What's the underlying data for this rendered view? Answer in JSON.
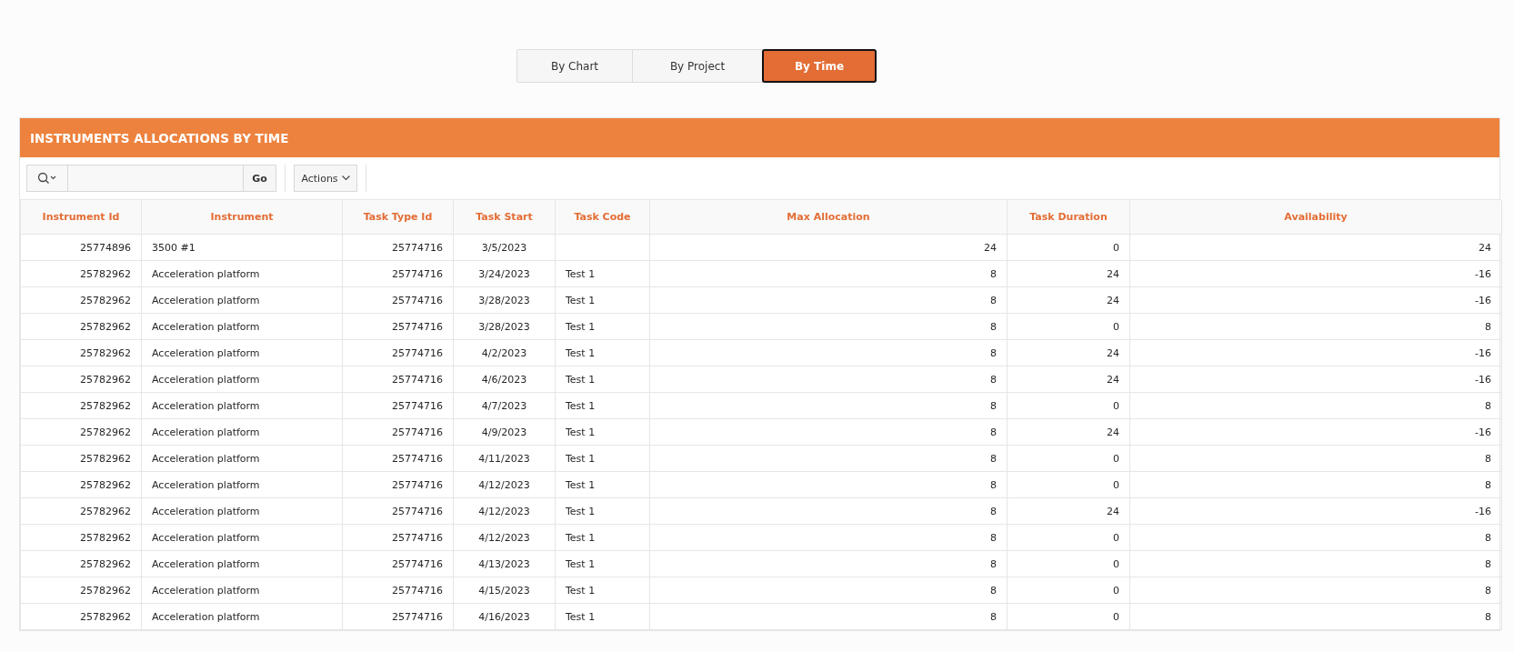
{
  "tabs": [
    {
      "label": "By Chart",
      "selected": false
    },
    {
      "label": "By Project",
      "selected": false
    },
    {
      "label": "By Time",
      "selected": true
    }
  ],
  "region": {
    "title": "INSTRUMENTS ALLOCATIONS BY TIME"
  },
  "toolbar": {
    "go_button": "Go",
    "actions_button": "Actions"
  },
  "table": {
    "columns": [
      "Instrument Id",
      "Instrument",
      "Task Type Id",
      "Task Start",
      "Task Code",
      "Max Allocation",
      "Task Duration",
      "Availability"
    ],
    "rows": [
      [
        "25774896",
        "3500 #1",
        "25774716",
        "3/5/2023",
        "",
        "24",
        "0",
        "24"
      ],
      [
        "25782962",
        "Acceleration platform",
        "25774716",
        "3/24/2023",
        "Test 1",
        "8",
        "24",
        "-16"
      ],
      [
        "25782962",
        "Acceleration platform",
        "25774716",
        "3/28/2023",
        "Test 1",
        "8",
        "24",
        "-16"
      ],
      [
        "25782962",
        "Acceleration platform",
        "25774716",
        "3/28/2023",
        "Test 1",
        "8",
        "0",
        "8"
      ],
      [
        "25782962",
        "Acceleration platform",
        "25774716",
        "4/2/2023",
        "Test 1",
        "8",
        "24",
        "-16"
      ],
      [
        "25782962",
        "Acceleration platform",
        "25774716",
        "4/6/2023",
        "Test 1",
        "8",
        "24",
        "-16"
      ],
      [
        "25782962",
        "Acceleration platform",
        "25774716",
        "4/7/2023",
        "Test 1",
        "8",
        "0",
        "8"
      ],
      [
        "25782962",
        "Acceleration platform",
        "25774716",
        "4/9/2023",
        "Test 1",
        "8",
        "24",
        "-16"
      ],
      [
        "25782962",
        "Acceleration platform",
        "25774716",
        "4/11/2023",
        "Test 1",
        "8",
        "0",
        "8"
      ],
      [
        "25782962",
        "Acceleration platform",
        "25774716",
        "4/12/2023",
        "Test 1",
        "8",
        "0",
        "8"
      ],
      [
        "25782962",
        "Acceleration platform",
        "25774716",
        "4/12/2023",
        "Test 1",
        "8",
        "24",
        "-16"
      ],
      [
        "25782962",
        "Acceleration platform",
        "25774716",
        "4/12/2023",
        "Test 1",
        "8",
        "0",
        "8"
      ],
      [
        "25782962",
        "Acceleration platform",
        "25774716",
        "4/13/2023",
        "Test 1",
        "8",
        "0",
        "8"
      ],
      [
        "25782962",
        "Acceleration platform",
        "25774716",
        "4/15/2023",
        "Test 1",
        "8",
        "0",
        "8"
      ],
      [
        "25782962",
        "Acceleration platform",
        "25774716",
        "4/16/2023",
        "Test 1",
        "8",
        "0",
        "8"
      ]
    ]
  }
}
